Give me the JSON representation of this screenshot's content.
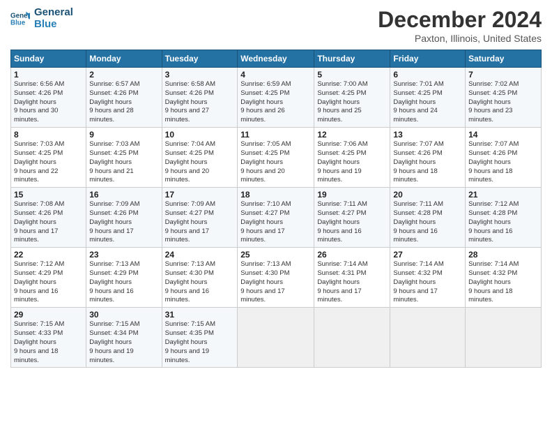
{
  "header": {
    "logo_line1": "General",
    "logo_line2": "Blue",
    "month_title": "December 2024",
    "location": "Paxton, Illinois, United States"
  },
  "days_of_week": [
    "Sunday",
    "Monday",
    "Tuesday",
    "Wednesday",
    "Thursday",
    "Friday",
    "Saturday"
  ],
  "weeks": [
    [
      {
        "num": "1",
        "sunrise": "6:56 AM",
        "sunset": "4:26 PM",
        "daylight": "9 hours and 30 minutes."
      },
      {
        "num": "2",
        "sunrise": "6:57 AM",
        "sunset": "4:26 PM",
        "daylight": "9 hours and 28 minutes."
      },
      {
        "num": "3",
        "sunrise": "6:58 AM",
        "sunset": "4:26 PM",
        "daylight": "9 hours and 27 minutes."
      },
      {
        "num": "4",
        "sunrise": "6:59 AM",
        "sunset": "4:25 PM",
        "daylight": "9 hours and 26 minutes."
      },
      {
        "num": "5",
        "sunrise": "7:00 AM",
        "sunset": "4:25 PM",
        "daylight": "9 hours and 25 minutes."
      },
      {
        "num": "6",
        "sunrise": "7:01 AM",
        "sunset": "4:25 PM",
        "daylight": "9 hours and 24 minutes."
      },
      {
        "num": "7",
        "sunrise": "7:02 AM",
        "sunset": "4:25 PM",
        "daylight": "9 hours and 23 minutes."
      }
    ],
    [
      {
        "num": "8",
        "sunrise": "7:03 AM",
        "sunset": "4:25 PM",
        "daylight": "9 hours and 22 minutes."
      },
      {
        "num": "9",
        "sunrise": "7:03 AM",
        "sunset": "4:25 PM",
        "daylight": "9 hours and 21 minutes."
      },
      {
        "num": "10",
        "sunrise": "7:04 AM",
        "sunset": "4:25 PM",
        "daylight": "9 hours and 20 minutes."
      },
      {
        "num": "11",
        "sunrise": "7:05 AM",
        "sunset": "4:25 PM",
        "daylight": "9 hours and 20 minutes."
      },
      {
        "num": "12",
        "sunrise": "7:06 AM",
        "sunset": "4:25 PM",
        "daylight": "9 hours and 19 minutes."
      },
      {
        "num": "13",
        "sunrise": "7:07 AM",
        "sunset": "4:26 PM",
        "daylight": "9 hours and 18 minutes."
      },
      {
        "num": "14",
        "sunrise": "7:07 AM",
        "sunset": "4:26 PM",
        "daylight": "9 hours and 18 minutes."
      }
    ],
    [
      {
        "num": "15",
        "sunrise": "7:08 AM",
        "sunset": "4:26 PM",
        "daylight": "9 hours and 17 minutes."
      },
      {
        "num": "16",
        "sunrise": "7:09 AM",
        "sunset": "4:26 PM",
        "daylight": "9 hours and 17 minutes."
      },
      {
        "num": "17",
        "sunrise": "7:09 AM",
        "sunset": "4:27 PM",
        "daylight": "9 hours and 17 minutes."
      },
      {
        "num": "18",
        "sunrise": "7:10 AM",
        "sunset": "4:27 PM",
        "daylight": "9 hours and 17 minutes."
      },
      {
        "num": "19",
        "sunrise": "7:11 AM",
        "sunset": "4:27 PM",
        "daylight": "9 hours and 16 minutes."
      },
      {
        "num": "20",
        "sunrise": "7:11 AM",
        "sunset": "4:28 PM",
        "daylight": "9 hours and 16 minutes."
      },
      {
        "num": "21",
        "sunrise": "7:12 AM",
        "sunset": "4:28 PM",
        "daylight": "9 hours and 16 minutes."
      }
    ],
    [
      {
        "num": "22",
        "sunrise": "7:12 AM",
        "sunset": "4:29 PM",
        "daylight": "9 hours and 16 minutes."
      },
      {
        "num": "23",
        "sunrise": "7:13 AM",
        "sunset": "4:29 PM",
        "daylight": "9 hours and 16 minutes."
      },
      {
        "num": "24",
        "sunrise": "7:13 AM",
        "sunset": "4:30 PM",
        "daylight": "9 hours and 16 minutes."
      },
      {
        "num": "25",
        "sunrise": "7:13 AM",
        "sunset": "4:30 PM",
        "daylight": "9 hours and 17 minutes."
      },
      {
        "num": "26",
        "sunrise": "7:14 AM",
        "sunset": "4:31 PM",
        "daylight": "9 hours and 17 minutes."
      },
      {
        "num": "27",
        "sunrise": "7:14 AM",
        "sunset": "4:32 PM",
        "daylight": "9 hours and 17 minutes."
      },
      {
        "num": "28",
        "sunrise": "7:14 AM",
        "sunset": "4:32 PM",
        "daylight": "9 hours and 18 minutes."
      }
    ],
    [
      {
        "num": "29",
        "sunrise": "7:15 AM",
        "sunset": "4:33 PM",
        "daylight": "9 hours and 18 minutes."
      },
      {
        "num": "30",
        "sunrise": "7:15 AM",
        "sunset": "4:34 PM",
        "daylight": "9 hours and 19 minutes."
      },
      {
        "num": "31",
        "sunrise": "7:15 AM",
        "sunset": "4:35 PM",
        "daylight": "9 hours and 19 minutes."
      },
      null,
      null,
      null,
      null
    ]
  ]
}
